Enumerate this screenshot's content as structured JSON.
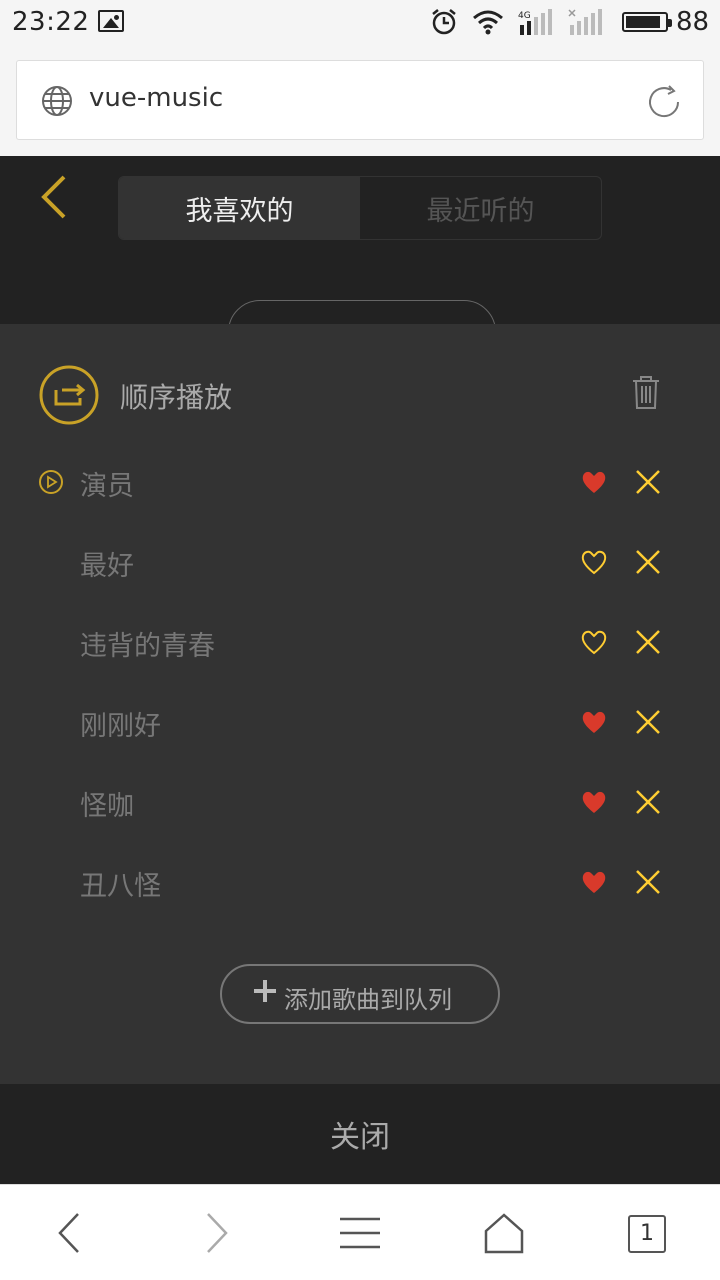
{
  "status_bar": {
    "time": "23:22",
    "network": "4G",
    "battery": "88"
  },
  "browser": {
    "url": "vue-music",
    "tab_count": "1"
  },
  "header": {
    "tabs": [
      {
        "label": "我喜欢的",
        "active": true
      },
      {
        "label": "最近听的",
        "active": false
      }
    ]
  },
  "playlist": {
    "mode_label": "顺序播放",
    "songs": [
      {
        "name": "演员",
        "playing": true,
        "favorite": true
      },
      {
        "name": "最好",
        "playing": false,
        "favorite": false
      },
      {
        "name": "违背的青春",
        "playing": false,
        "favorite": false
      },
      {
        "name": "刚刚好",
        "playing": false,
        "favorite": true
      },
      {
        "name": "怪咖",
        "playing": false,
        "favorite": true
      },
      {
        "name": "丑八怪",
        "playing": false,
        "favorite": true
      }
    ],
    "add_label": "添加歌曲到队列",
    "close_label": "关闭"
  },
  "colors": {
    "accent": "#c9a227",
    "favorite": "#d93a2b",
    "delete": "#ffcd32",
    "panel": "#333333",
    "background": "#222222"
  }
}
